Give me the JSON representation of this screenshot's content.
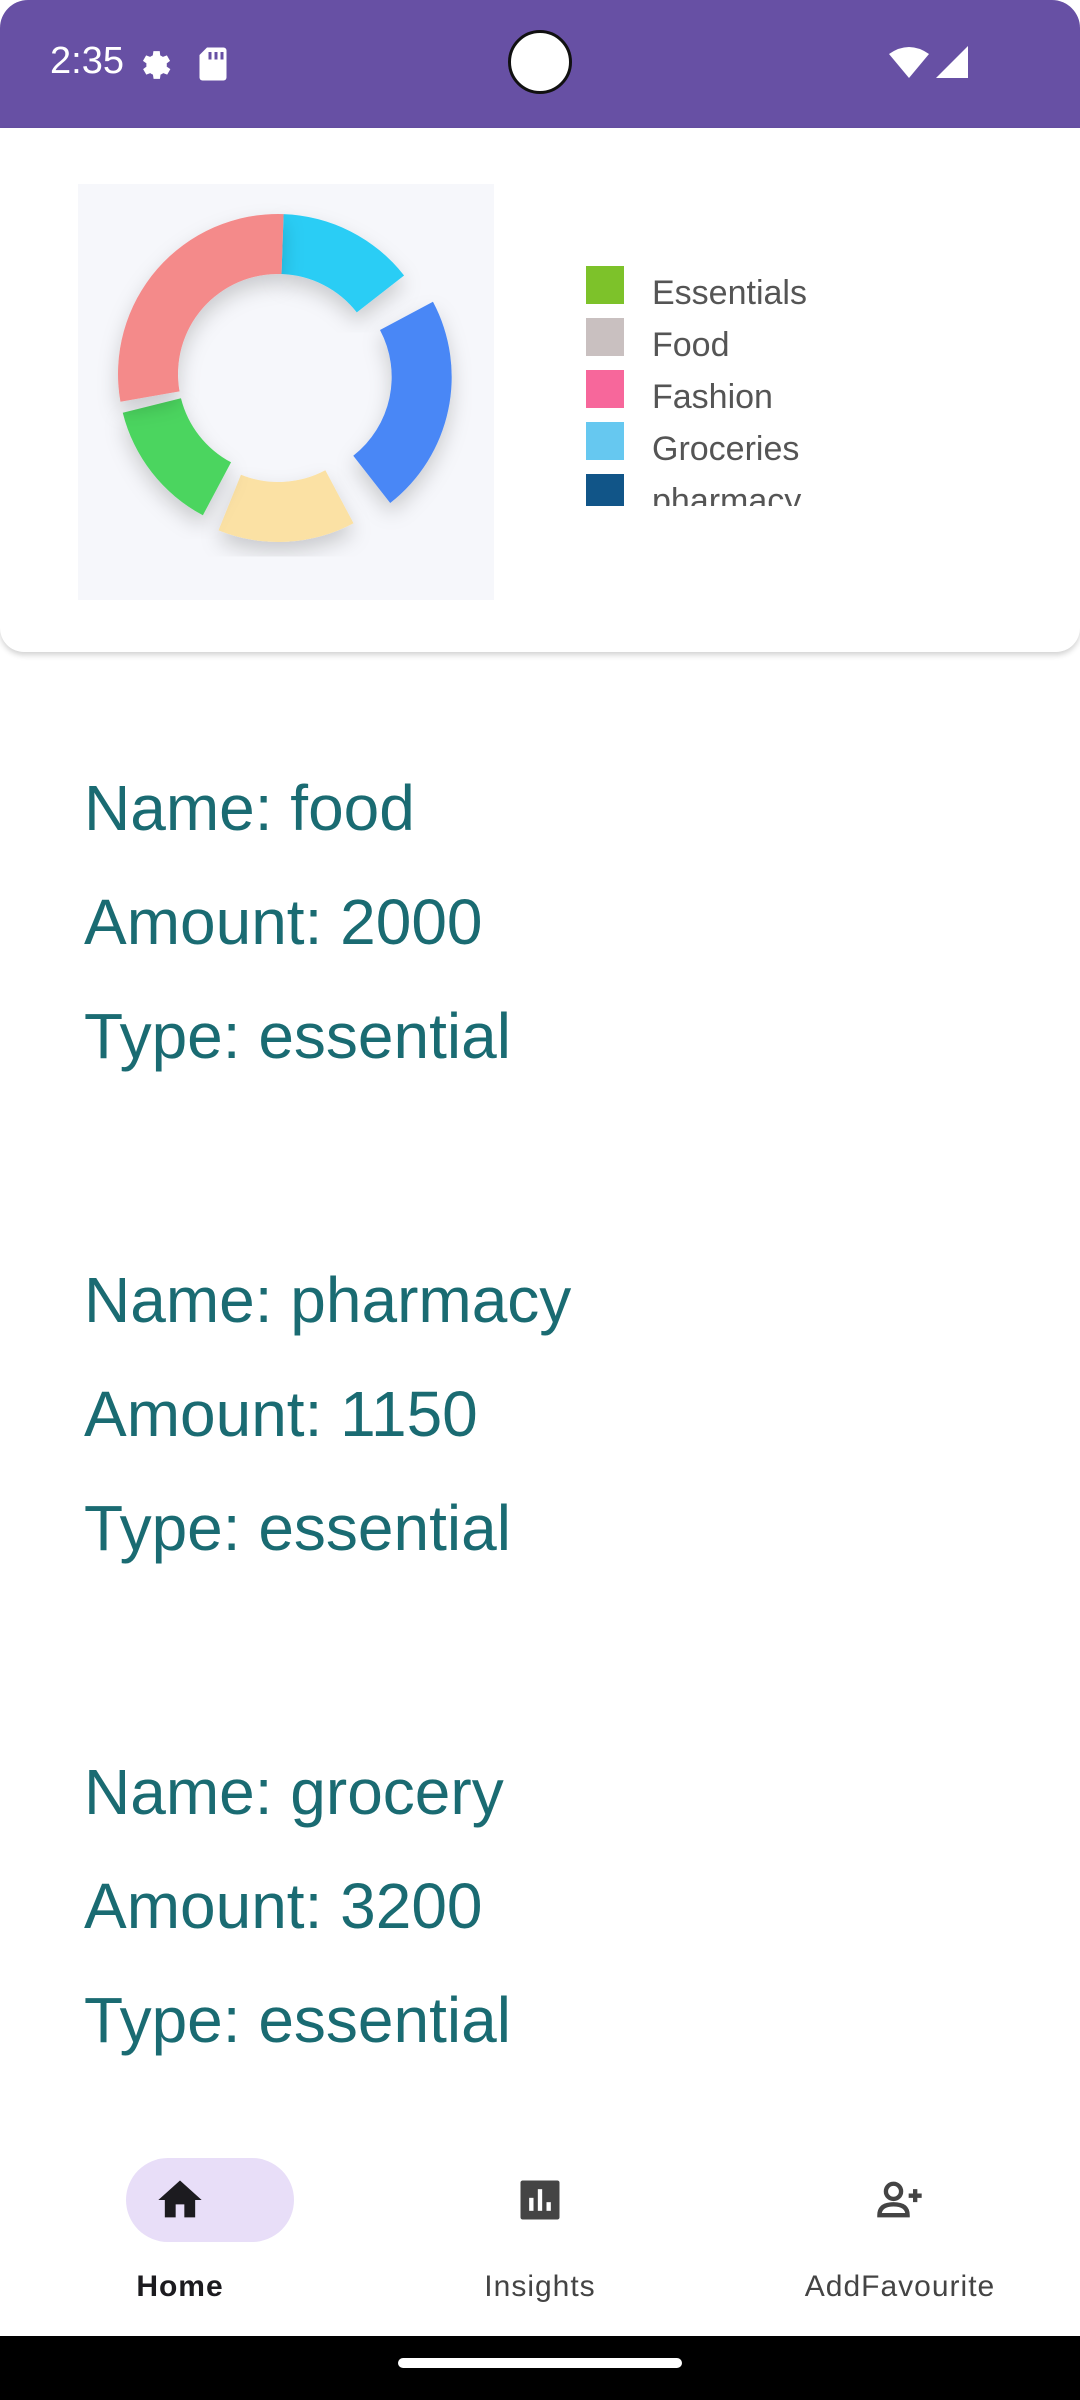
{
  "status_bar": {
    "time": "2:35",
    "color": "#6750a4",
    "icons": [
      "settings-icon",
      "sd-card-icon",
      "wifi-icon",
      "signal-icon"
    ]
  },
  "chart_card": {
    "chart_data": {
      "type": "pie",
      "title": "",
      "legend_position": "right",
      "categories": [
        "Essentials",
        "Food",
        "Fashion",
        "Groceries",
        "pharmacy"
      ],
      "colors": [
        "#7dc22a",
        "#c9c0c0",
        "#f7679b",
        "#66c8f0",
        "#115588"
      ]
    },
    "legend": [
      {
        "label": "Essentials",
        "color": "#7dc22a"
      },
      {
        "label": "Food",
        "color": "#c9c0c0"
      },
      {
        "label": "Fashion",
        "color": "#f7679b"
      },
      {
        "label": "Groceries",
        "color": "#66c8f0"
      },
      {
        "label": "pharmacy",
        "color": "#115588"
      }
    ]
  },
  "expenses": [
    {
      "name": "Name: food",
      "amount": "Amount: 2000",
      "type": "Type: essential"
    },
    {
      "name": "Name: pharmacy",
      "amount": "Amount: 1150",
      "type": "Type: essential"
    },
    {
      "name": "Name: grocery",
      "amount": "Amount: 3200",
      "type": "Type: essential"
    }
  ],
  "bottom_nav": {
    "items": [
      {
        "label": "Home",
        "icon": "home-icon",
        "active": true
      },
      {
        "label": "Insights",
        "icon": "insights-icon",
        "active": false
      },
      {
        "label": "AddFavourite",
        "icon": "add-person-icon",
        "active": false
      }
    ],
    "active_pill_color": "#e8def8"
  },
  "colors": {
    "text_primary": "#1a6b72",
    "accent": "#6750a4"
  }
}
